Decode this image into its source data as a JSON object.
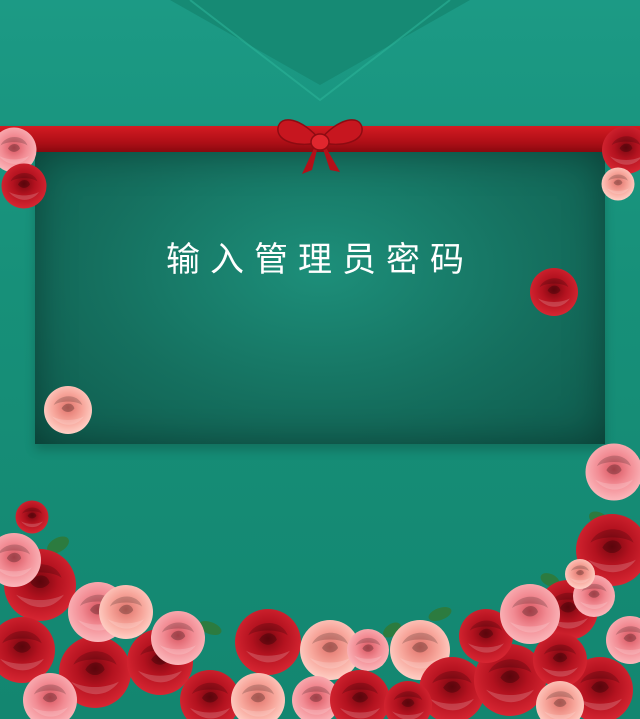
{
  "prompt": {
    "title": "输入管理员密码"
  },
  "colors": {
    "background": "#179079",
    "ribbon": "#c3141c",
    "card": "#15705f",
    "rose_red": "#b3121f",
    "rose_pink": "#f28b93"
  },
  "icons": {
    "bow": "ribbon-bow-icon",
    "rose": "rose-flower-icon"
  }
}
